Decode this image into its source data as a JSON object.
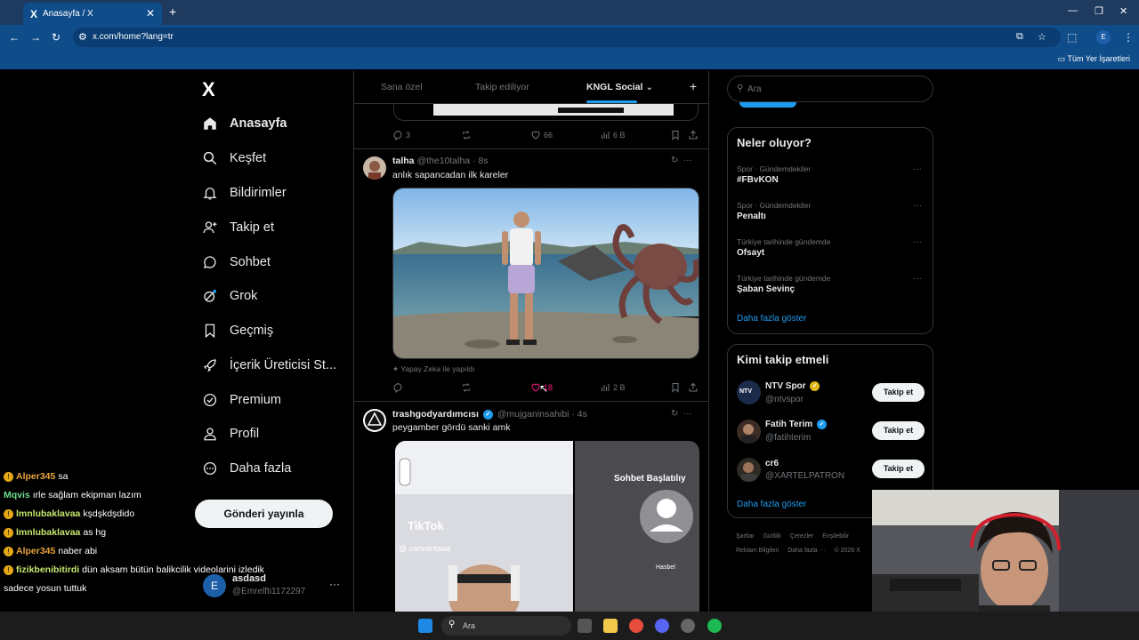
{
  "browser": {
    "tab_title": "Anasayfa / X",
    "tab_icon": "X",
    "url": "x.com/home?lang=tr",
    "bookmarks_label": "Tüm Yer İşaretleri",
    "profile_initial": "E"
  },
  "sidebar": {
    "logo": "X",
    "items": [
      {
        "label": "Anasayfa",
        "icon": "home-icon"
      },
      {
        "label": "Keşfet",
        "icon": "search-icon"
      },
      {
        "label": "Bildirimler",
        "icon": "bell-icon"
      },
      {
        "label": "Takip et",
        "icon": "add-person-icon"
      },
      {
        "label": "Sohbet",
        "icon": "chat-bubble-icon"
      },
      {
        "label": "Grok",
        "icon": "grok-icon"
      },
      {
        "label": "Geçmiş",
        "icon": "bookmark-icon"
      },
      {
        "label": "İçerik Üreticisi St...",
        "icon": "rocket-icon"
      },
      {
        "label": "Premium",
        "icon": "verified-icon"
      },
      {
        "label": "Profil",
        "icon": "person-icon"
      },
      {
        "label": "Daha fazla",
        "icon": "more-circle-icon"
      }
    ],
    "post_button": "Gönderi yayınla",
    "user": {
      "initial": "E",
      "name": "asdasd",
      "handle": "@Emrelfti1172297",
      "more": "···"
    }
  },
  "chat": [
    {
      "badge": true,
      "name": "Alper345",
      "color": "#e8a33c",
      "message": "sa"
    },
    {
      "badge": false,
      "name": "Mqvis",
      "color": "#6fdc8c",
      "message": "ırle sağlam ekipman lazım"
    },
    {
      "badge": true,
      "name": "lmnlubaklavaa",
      "color": "#c5e86c",
      "message": "kşdşkdşdido"
    },
    {
      "badge": true,
      "name": "lmnlubaklavaa",
      "color": "#c5e86c",
      "message": "as hg"
    },
    {
      "badge": true,
      "name": "Alper345",
      "color": "#e8a33c",
      "message": "naber abi"
    },
    {
      "badge": true,
      "name": "fizikbenibitirdi",
      "color": "#c5e86c",
      "message": "dün aksam bütün balikcilik videolarini izledik"
    },
    {
      "badge": false,
      "name": "",
      "color": "#ffffff",
      "message": "sadece yosun tuttuk"
    }
  ],
  "feed_tabs": [
    "Sana özel",
    "Takip ediliyor",
    "KNGL Social"
  ],
  "feed_tab_active_suffix": "⌄",
  "prev_tweet_actions": {
    "replies": "3",
    "retweets": "",
    "likes": "66",
    "views": "6 B"
  },
  "tweets": [
    {
      "name": "talha",
      "handle": "@the10talha",
      "time": "8s",
      "verified": false,
      "text": "anlık sapancadan ilk kareler",
      "ai_label": "Yapay Zeka ile yapıldı",
      "actions": {
        "replies": "",
        "retweets": "",
        "likes": "18",
        "views": "2 B"
      }
    },
    {
      "name": "trashgodyardımcısı",
      "handle": "@mujganinsahibi",
      "time": "4s",
      "verified": true,
      "text": "peygamber gördü sanki amk",
      "media_text_right": "Sohbet Başlatılıy",
      "media_caption_right": "Hasbel",
      "media_watermark": "TikTok",
      "media_watermark_handle": "@ canvantaaa"
    }
  ],
  "right": {
    "search_placeholder": "Ara",
    "trends_title": "Neler oluyor?",
    "trends": [
      {
        "category": "Spor · Gündemdekiler",
        "name": "#FBvKON"
      },
      {
        "category": "Spor · Gündemdekiler",
        "name": "Penaltı"
      },
      {
        "category": "Türkiye tarihinde gündemde",
        "name": "Ofsayt"
      },
      {
        "category": "Türkiye tarihinde gündemde",
        "name": "Şaban Sevinç"
      }
    ],
    "show_more": "Daha fazla göster",
    "wtf_title": "Kimi takip etmeli",
    "wtf": [
      {
        "name": "NTV Spor",
        "handle": "@ntvspor",
        "badge": "gold",
        "avatar_text": "NTV"
      },
      {
        "name": "Fatih Terim",
        "handle": "@fatihterim",
        "badge": "blue",
        "avatar_text": ""
      },
      {
        "name": "cr6",
        "handle": "@XARTELPATRON",
        "badge": "",
        "avatar_text": ""
      }
    ],
    "follow_label": "Takip et",
    "footer_row1": [
      "Şartlar",
      "Gizlilik",
      "Çerezler",
      "Erişilebilir"
    ],
    "footer_row2": [
      "Reklam Bilgileri",
      "Daha fazla ···",
      "© 2026 X"
    ]
  },
  "taskbar": {
    "search_placeholder": "Ara"
  },
  "colors": {
    "accent": "#1d9bf0",
    "like": "#f91880",
    "chrome": "#0f4c8a"
  }
}
